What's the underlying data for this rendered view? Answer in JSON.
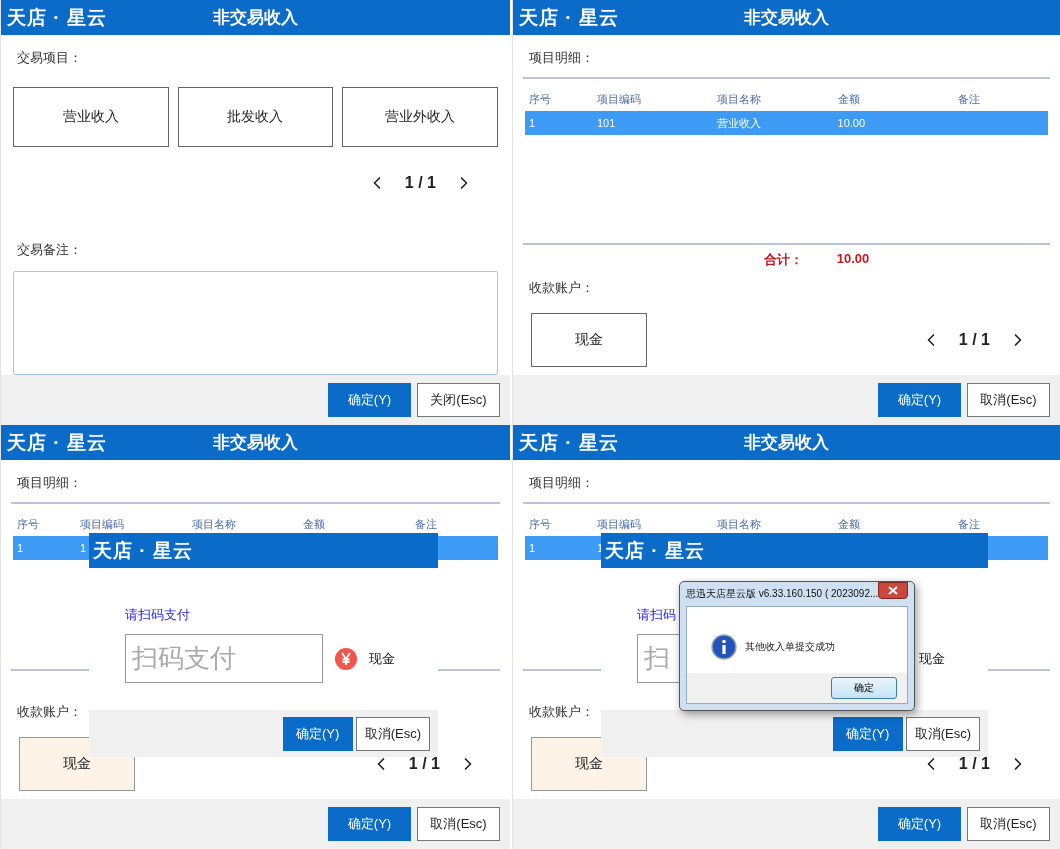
{
  "panels": [
    {
      "kind": "items",
      "brand": "天店 · 星云",
      "title": "非交易收入",
      "items_label": "交易项目：",
      "items": [
        "营业收入",
        "批发收入",
        "营业外收入"
      ],
      "pager": "1 / 1",
      "remark_label": "交易备注：",
      "buttons": [
        {
          "label": "确定(Y)",
          "primary": true
        },
        {
          "label": "关闭(Esc)",
          "primary": false
        }
      ]
    },
    {
      "kind": "detail",
      "brand": "天店 · 星云",
      "title": "非交易收入",
      "detail_label": "项目明细：",
      "columns": [
        "序号",
        "项目编码",
        "项目名称",
        "金额",
        "备注"
      ],
      "rows": [
        {
          "cells": [
            "1",
            "101",
            "营业收入",
            "10.00"
          ],
          "selected": true
        }
      ],
      "total": {
        "label": "合计：",
        "value": "10.00"
      },
      "account_label": "收款账户：",
      "accounts": [
        {
          "label": "现金",
          "selected": false
        }
      ],
      "pager": "1 / 1",
      "buttons": [
        {
          "label": "确定(Y)",
          "primary": true
        },
        {
          "label": "取消(Esc)",
          "primary": false
        }
      ]
    },
    {
      "kind": "detail",
      "brand": "天店 · 星云",
      "title": "非交易收入",
      "detail_label": "项目明细：",
      "columns": [
        "序号",
        "项目编码",
        "项目名称",
        "金额",
        "备注"
      ],
      "rows": [
        {
          "cells": [
            "1",
            "1"
          ],
          "selected": true
        }
      ],
      "account_label": "收款账户：",
      "accounts": [
        {
          "label": "现金",
          "selected": true
        }
      ],
      "pager": "1 / 1",
      "buttons": [
        {
          "label": "确定(Y)",
          "primary": true
        },
        {
          "label": "取消(Esc)",
          "primary": false
        }
      ],
      "overlay": {
        "brand": "天店 · 星云",
        "prompt": "请扫码支付",
        "placeholder": "扫码支付",
        "pay": {
          "label": "现金",
          "icon": true
        },
        "buttons": [
          {
            "label": "确定(Y)",
            "primary": true
          },
          {
            "label": "取消(Esc)",
            "primary": false
          }
        ]
      }
    },
    {
      "kind": "detail",
      "brand": "天店 · 星云",
      "title": "非交易收入",
      "detail_label": "项目明细：",
      "columns": [
        "序号",
        "项目编码",
        "项目名称",
        "金额",
        "备注"
      ],
      "rows": [
        {
          "cells": [
            "1",
            "1"
          ],
          "selected": true
        }
      ],
      "account_label": "收款账户：",
      "accounts": [
        {
          "label": "现金",
          "selected": true
        }
      ],
      "pager": "1 / 1",
      "buttons": [
        {
          "label": "确定(Y)",
          "primary": true
        },
        {
          "label": "取消(Esc)",
          "primary": false
        }
      ],
      "overlay": {
        "brand": "天店 · 星云",
        "prompt": "请扫码",
        "placeholder": "扫",
        "pay": {
          "label": "现金",
          "icon": false
        },
        "buttons": [
          {
            "label": "确定(Y)",
            "primary": true
          },
          {
            "label": "取消(Esc)",
            "primary": false
          }
        ]
      },
      "message_box": {
        "title": "思迅天店星云版 v6.33.160.150 ( 2023092...",
        "message": "其他收入单提交成功",
        "button": "确定"
      }
    }
  ]
}
